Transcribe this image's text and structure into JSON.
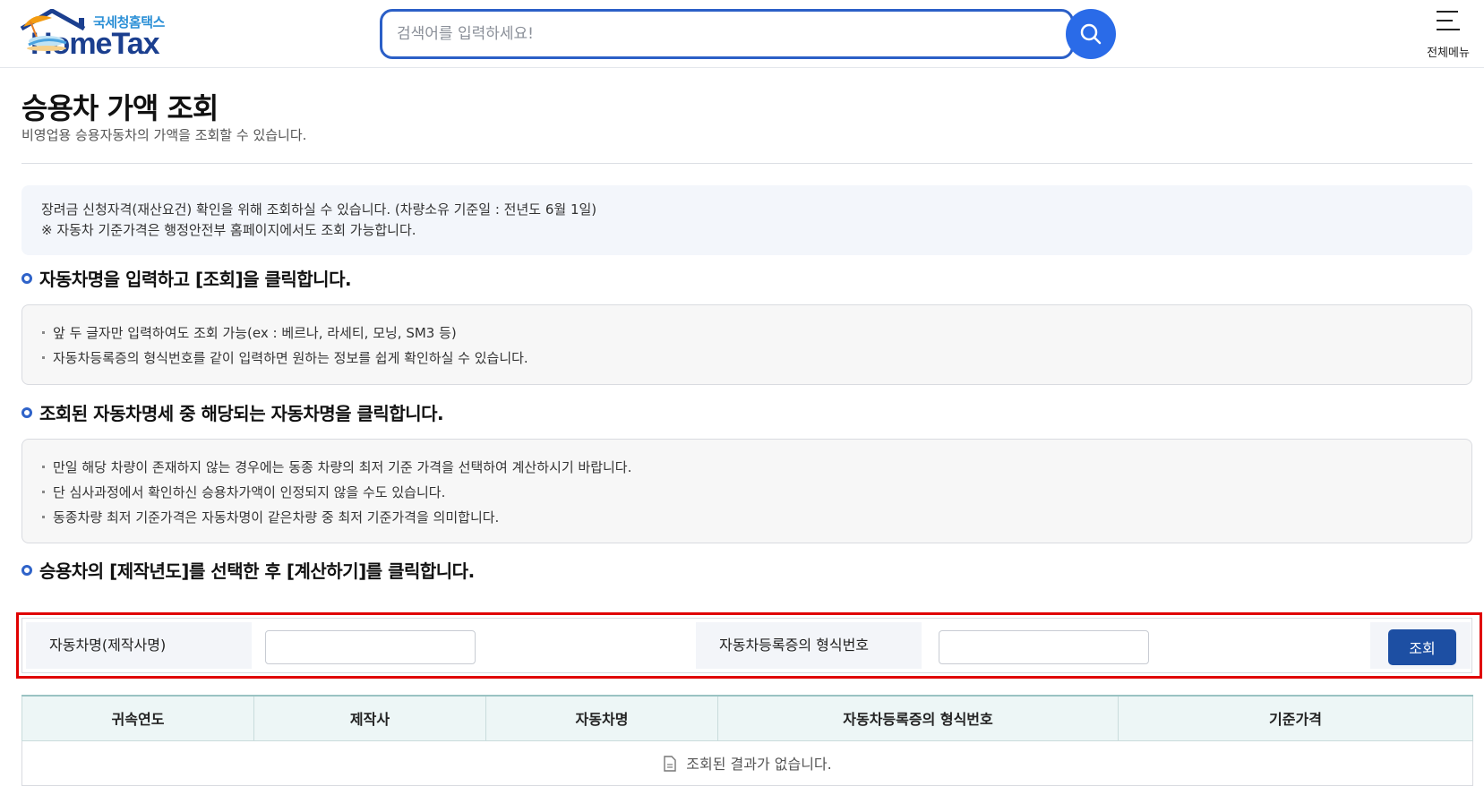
{
  "header": {
    "logo_sub": "국세청홈택스",
    "logo_main": "HomeTax",
    "search_placeholder": "검색어를 입력하세요!",
    "menu_label": "전체메뉴"
  },
  "page": {
    "title": "승용차 가액 조회",
    "description": "비영업용 승용자동차의 가액을 조회할 수 있습니다."
  },
  "notice": {
    "line1": "장려금 신청자격(재산요건) 확인을 위해 조회하실 수 있습니다. (차량소유 기준일 : 전년도 6월 1일)",
    "line2": "※ 자동차 기준가격은 행정안전부 홈페이지에서도 조회 가능합니다."
  },
  "sections": [
    {
      "heading": "자동차명을 입력하고 [조회]을 클릭합니다.",
      "items": [
        "앞 두 글자만 입력하여도 조회 가능(ex : 베르나, 라세티, 모닝, SM3 등)",
        "자동차등록증의 형식번호를 같이 입력하면 원하는 정보를 쉽게 확인하실 수 있습니다."
      ]
    },
    {
      "heading": "조회된 자동차명세 중 해당되는 자동차명을 클릭합니다.",
      "items": [
        "만일 해당 차량이 존재하지 않는 경우에는 동종 차량의 최저 기준 가격을 선택하여 계산하시기 바랍니다.",
        "단 심사과정에서 확인하신 승용차가액이 인정되지 않을 수도 있습니다.",
        "동종차량 최저 기준가격은 자동차명이 같은차량 중  최저 기준가격을 의미합니다."
      ]
    },
    {
      "heading": "승용차의 [제작년도]를 선택한 후 [계산하기]를 클릭합니다."
    }
  ],
  "form": {
    "car_name_label": "자동차명(제작사명)",
    "car_name_value": "",
    "type_no_label": "자동차등록증의 형식번호",
    "type_no_value": "",
    "query_button": "조회"
  },
  "table": {
    "headers": [
      "귀속연도",
      "제작사",
      "자동차명",
      "자동차등록증의 형식번호",
      "기준가격"
    ],
    "empty_message": "조회된 결과가 없습니다."
  },
  "colors": {
    "primary": "#1d4fa3",
    "search_border": "#2b5fc7",
    "highlight": "#e00000"
  }
}
